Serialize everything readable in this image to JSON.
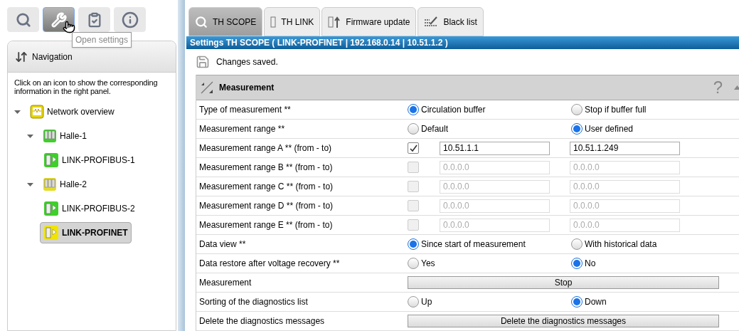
{
  "toolbar": [
    {
      "kind": "search",
      "selected": false
    },
    {
      "kind": "settings",
      "selected": true
    },
    {
      "kind": "checklist",
      "selected": false
    },
    {
      "kind": "info",
      "selected": false
    }
  ],
  "tooltip": "Open settings",
  "navigation": {
    "title": "Navigation",
    "hint": "Click on an icon to show the corresponding information in the right panel.",
    "tree": [
      {
        "label": "Network overview",
        "kind": "network",
        "color": "#e6d400",
        "expanded": true,
        "selected": false,
        "children": [
          {
            "label": "Halle-1",
            "kind": "hall",
            "color": "#3fcf2a",
            "expanded": true,
            "selected": false,
            "children": [
              {
                "label": "LINK-PROFIBUS-1",
                "kind": "device",
                "color": "#3fcf2a",
                "selected": false
              }
            ]
          },
          {
            "label": "Halle-2",
            "kind": "hall",
            "color": "#e3dc2a",
            "expanded": true,
            "selected": false,
            "children": [
              {
                "label": "LINK-PROFIBUS-2",
                "kind": "device",
                "color": "#3fcf2a",
                "selected": false
              },
              {
                "label": "LINK-PROFINET",
                "kind": "device",
                "color": "#f0e400",
                "selected": true
              }
            ]
          }
        ]
      }
    ]
  },
  "tabs": [
    {
      "label": "TH SCOPE",
      "kind": "scope",
      "selected": true
    },
    {
      "label": "TH LINK",
      "kind": "link",
      "selected": false
    },
    {
      "label": "Firmware update",
      "kind": "firmware",
      "selected": false
    },
    {
      "label": "Black list",
      "kind": "blacklist",
      "selected": false
    }
  ],
  "settings_title": "Settings TH SCOPE ( LINK-PROFINET | 192.168.0.14 | 10.51.1.2 )",
  "status_message": "Changes saved.",
  "section": {
    "title": "Measurement",
    "help": "?",
    "expanded": true,
    "rows": [
      {
        "kind": "radio",
        "label": "Type of measurement **",
        "options": [
          {
            "label": "Circulation buffer",
            "selected": true
          },
          {
            "label": "Stop if buffer full",
            "selected": false
          }
        ]
      },
      {
        "kind": "radio",
        "label": "Measurement range **",
        "options": [
          {
            "label": "Default",
            "selected": false
          },
          {
            "label": "User defined",
            "selected": true
          }
        ]
      },
      {
        "kind": "range",
        "label": "Measurement range A ** (from - to)",
        "checked": true,
        "from": "10.51.1.1",
        "to": "10.51.1.249"
      },
      {
        "kind": "range",
        "label": "Measurement range B ** (from - to)",
        "checked": false,
        "from": "0.0.0.0",
        "to": "0.0.0.0"
      },
      {
        "kind": "range",
        "label": "Measurement range C ** (from - to)",
        "checked": false,
        "from": "0.0.0.0",
        "to": "0.0.0.0"
      },
      {
        "kind": "range",
        "label": "Measurement range D ** (from - to)",
        "checked": false,
        "from": "0.0.0.0",
        "to": "0.0.0.0"
      },
      {
        "kind": "range",
        "label": "Measurement range E ** (from - to)",
        "checked": false,
        "from": "0.0.0.0",
        "to": "0.0.0.0"
      },
      {
        "kind": "radio",
        "label": "Data view **",
        "options": [
          {
            "label": "Since start of measurement",
            "selected": true
          },
          {
            "label": "With historical data",
            "selected": false
          }
        ]
      },
      {
        "kind": "radio",
        "label": "Data restore after voltage recovery **",
        "options": [
          {
            "label": "Yes",
            "selected": false
          },
          {
            "label": "No",
            "selected": true
          }
        ]
      },
      {
        "kind": "button",
        "label": "Measurement",
        "button": "Stop"
      },
      {
        "kind": "radio",
        "label": "Sorting of the diagnostics list",
        "options": [
          {
            "label": "Up",
            "selected": false
          },
          {
            "label": "Down",
            "selected": true
          }
        ]
      },
      {
        "kind": "button",
        "label": "Delete the diagnostics messages",
        "button": "Delete the diagnostics messages"
      }
    ]
  }
}
